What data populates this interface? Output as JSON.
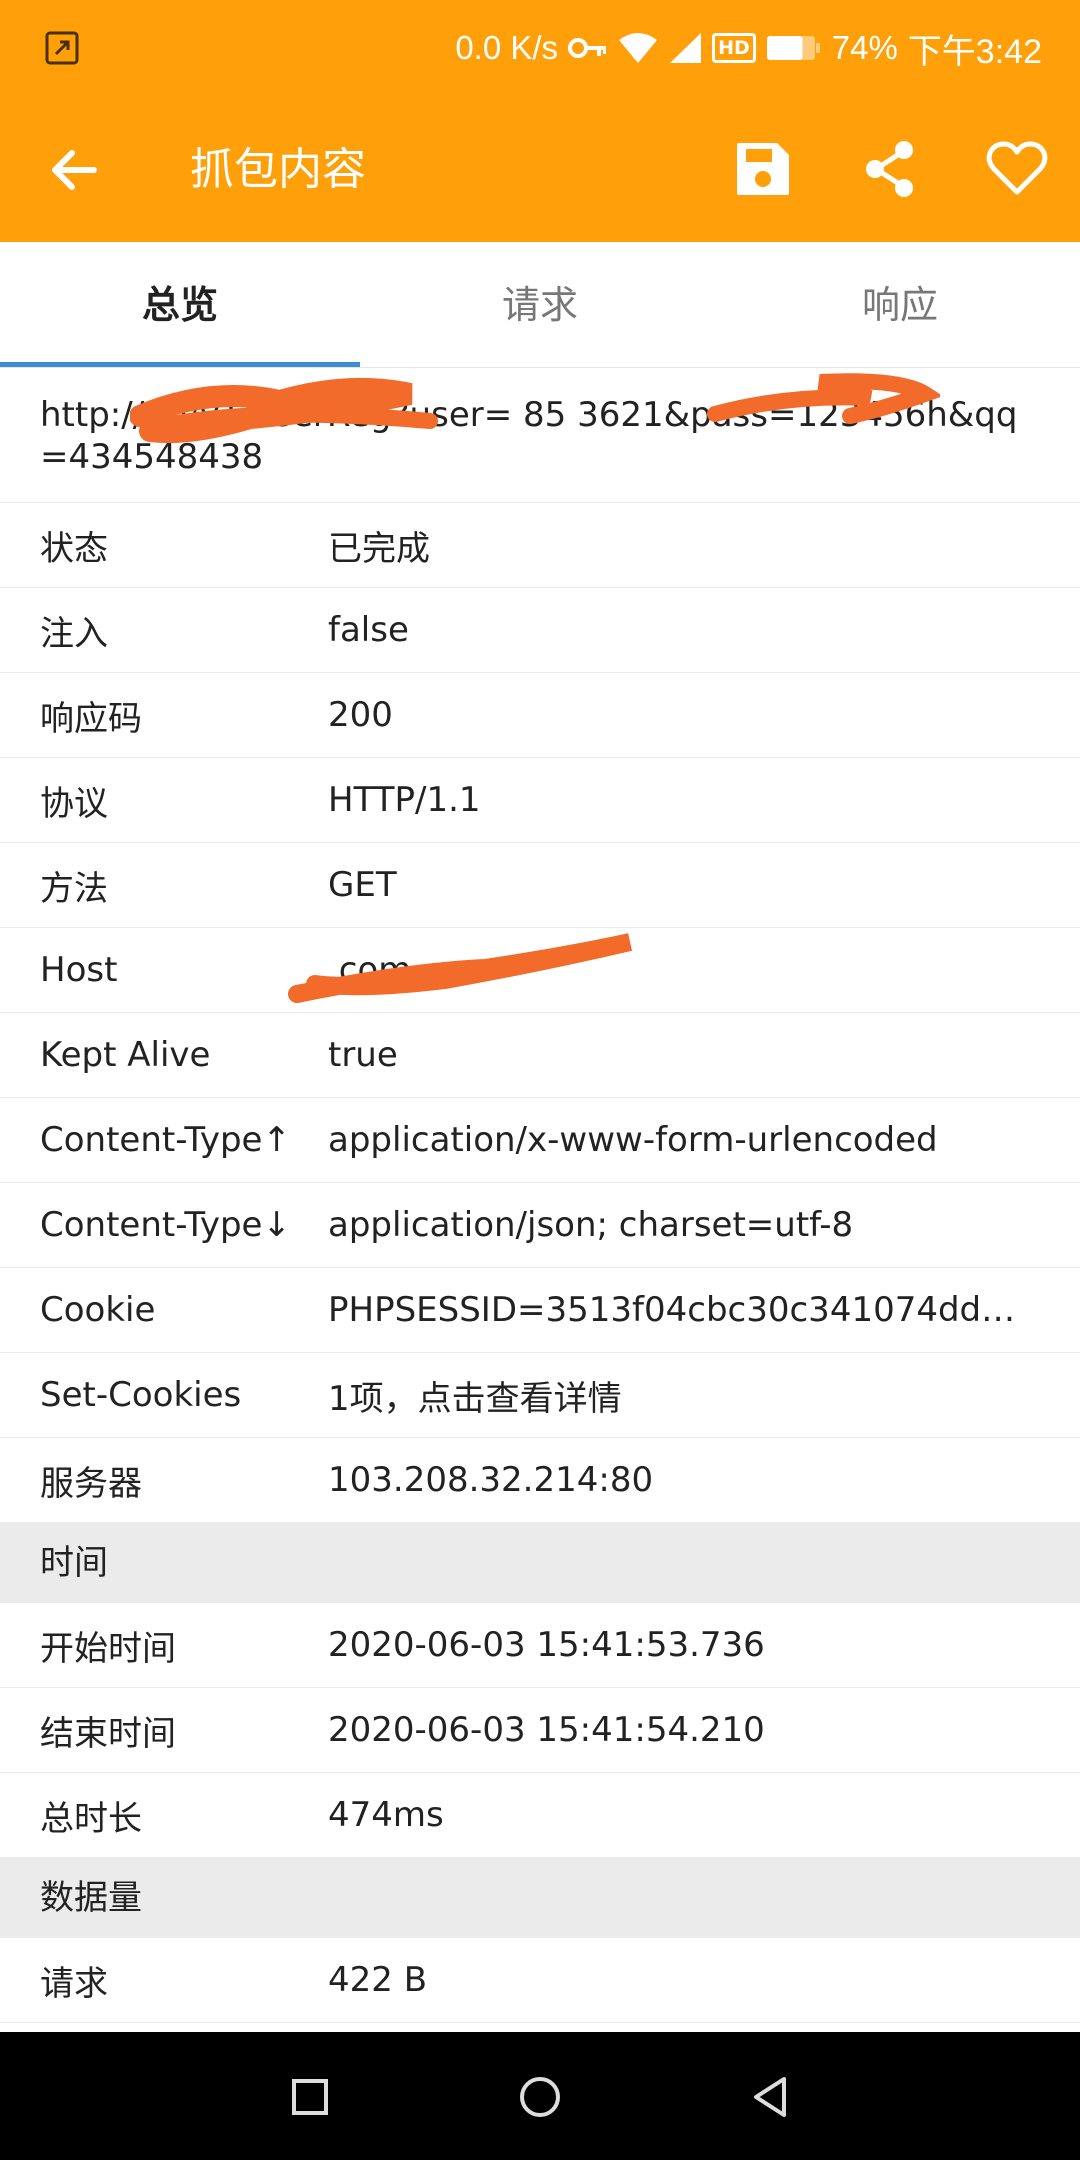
{
  "status_bar": {
    "net_speed": "0.0 K/s",
    "hd_badge": "HD",
    "battery_percent": "74%",
    "time": "下午3:42",
    "battery_level": 0.74,
    "icons": [
      "app-notification-icon",
      "key-icon",
      "wifi-icon",
      "signal-icon",
      "hd-icon",
      "battery-icon"
    ]
  },
  "toolbar": {
    "title": "抓包内容",
    "background": "#FFA00A",
    "icons": [
      "back-arrow-icon",
      "save-icon",
      "share-icon",
      "heart-icon"
    ]
  },
  "tabs": [
    {
      "label": "总览",
      "active": true
    },
    {
      "label": "请求",
      "active": false
    },
    {
      "label": "响应",
      "active": false
    }
  ],
  "accent": "#3B8CD1",
  "url": "http://                    m/v1/userReg?user=         85   3621&pass=123456h&qq=434548438",
  "rows": [
    {
      "key": "状态",
      "value": "已完成"
    },
    {
      "key": "注入",
      "value": "false"
    },
    {
      "key": "响应码",
      "value": "200"
    },
    {
      "key": "协议",
      "value": "HTTP/1.1"
    },
    {
      "key": "方法",
      "value": "GET"
    },
    {
      "key": "Host",
      "value": "                  .com"
    },
    {
      "key": "Kept Alive",
      "value": "true"
    },
    {
      "key": "Content-Type↑",
      "value": "application/x-www-form-urlencoded"
    },
    {
      "key": "Content-Type↓",
      "value": "application/json; charset=utf-8"
    },
    {
      "key": "Cookie",
      "value": "PHPSESSID=3513f04cbc30c341074dd…"
    },
    {
      "key": "Set-Cookies",
      "value": "1项，点击查看详情"
    },
    {
      "key": "服务器",
      "value": "103.208.32.214:80"
    }
  ],
  "time_section": {
    "title": "时间",
    "rows": [
      {
        "key": "开始时间",
        "value": "2020-06-03 15:41:53.736"
      },
      {
        "key": "结束时间",
        "value": "2020-06-03 15:41:54.210"
      },
      {
        "key": "总时长",
        "value": "474ms"
      }
    ]
  },
  "data_section": {
    "title": "数据量",
    "rows": [
      {
        "key": "请求",
        "value": "422 B"
      }
    ]
  },
  "nav_bar": {
    "icons": [
      "recent-apps-icon",
      "home-icon",
      "nav-back-icon"
    ]
  },
  "redaction_color": "#F26B2A"
}
